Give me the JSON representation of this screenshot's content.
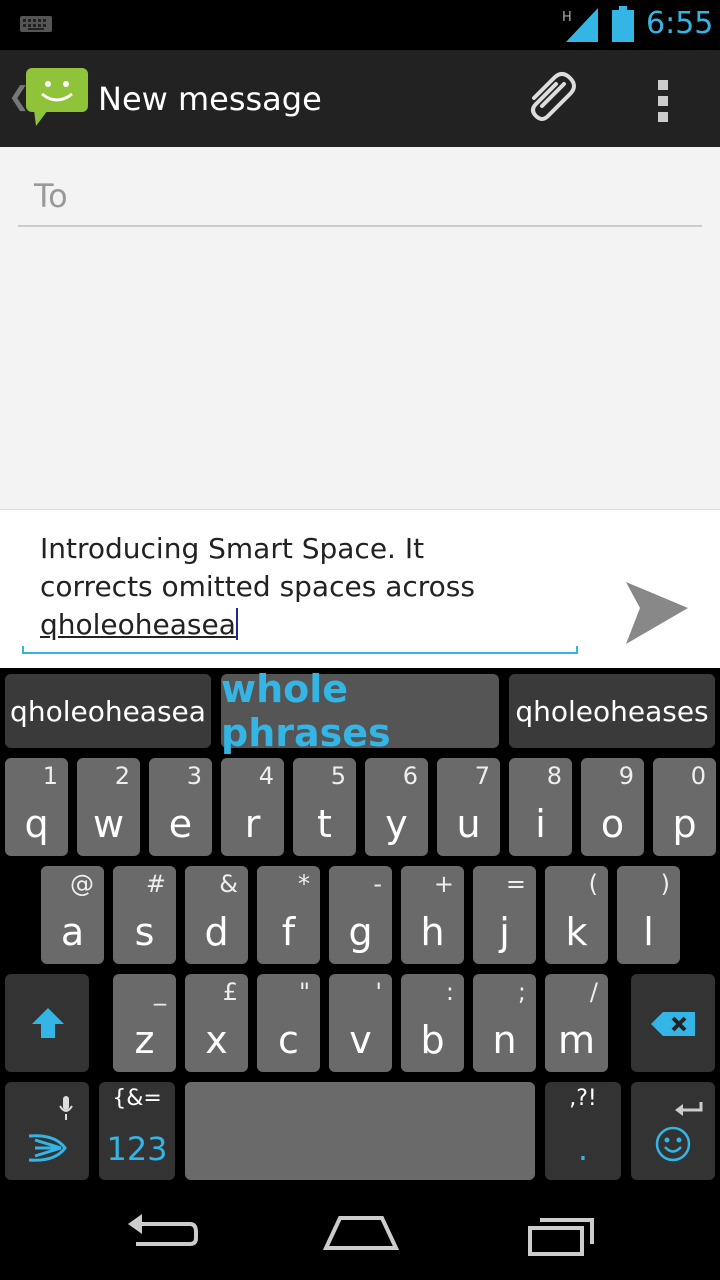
{
  "status_bar": {
    "time": "6:55",
    "network_label": "H",
    "icons": [
      "keyboard-icon",
      "signal-icon",
      "battery-icon"
    ]
  },
  "action_bar": {
    "title": "New message",
    "icons": [
      "messaging-app-icon",
      "attach-icon",
      "overflow-menu-icon"
    ]
  },
  "compose": {
    "to_placeholder": "To",
    "message_line1": "Introducing Smart Space. It",
    "message_line2": "corrects omitted spaces across",
    "message_current_word": "qholeoheasea"
  },
  "keyboard": {
    "suggestions": [
      "qholeoheasea",
      "whole phrases",
      "qholeoheases"
    ],
    "row1": [
      {
        "letter": "q",
        "sub": "1"
      },
      {
        "letter": "w",
        "sub": "2"
      },
      {
        "letter": "e",
        "sub": "3"
      },
      {
        "letter": "r",
        "sub": "4"
      },
      {
        "letter": "t",
        "sub": "5"
      },
      {
        "letter": "y",
        "sub": "6"
      },
      {
        "letter": "u",
        "sub": "7"
      },
      {
        "letter": "i",
        "sub": "8"
      },
      {
        "letter": "o",
        "sub": "9"
      },
      {
        "letter": "p",
        "sub": "0"
      }
    ],
    "row2": [
      {
        "letter": "a",
        "sub": "@"
      },
      {
        "letter": "s",
        "sub": "#"
      },
      {
        "letter": "d",
        "sub": "&"
      },
      {
        "letter": "f",
        "sub": "*"
      },
      {
        "letter": "g",
        "sub": "-"
      },
      {
        "letter": "h",
        "sub": "+"
      },
      {
        "letter": "j",
        "sub": "="
      },
      {
        "letter": "k",
        "sub": "("
      },
      {
        "letter": "l",
        "sub": ")"
      }
    ],
    "row3": [
      {
        "letter": "z",
        "sub": "_"
      },
      {
        "letter": "x",
        "sub": "£"
      },
      {
        "letter": "c",
        "sub": "\""
      },
      {
        "letter": "v",
        "sub": "'"
      },
      {
        "letter": "b",
        "sub": ":"
      },
      {
        "letter": "n",
        "sub": ";"
      },
      {
        "letter": "m",
        "sub": "/"
      }
    ],
    "numbers_key": {
      "symbols": "{&=",
      "label": "123"
    },
    "period_key": {
      "symbols": ",?!",
      "label": "."
    },
    "accent_color": "#33b5e5"
  }
}
